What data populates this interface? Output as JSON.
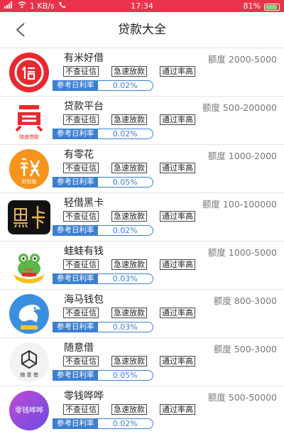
{
  "status_bar": {
    "left": "1 KB/s",
    "time": "17:34",
    "battery_pct": "81%"
  },
  "header": {
    "title": "贷款大全"
  },
  "colors": {
    "status": "#e9334a",
    "rate_blue": "#3b7fd4"
  },
  "loans": [
    {
      "name": "有米好借",
      "limit": "额度 2000-5000",
      "tags": [
        "不查征信",
        "急速放款",
        "通过率高"
      ],
      "rate_label": "参考日利率",
      "rate": "0.02%"
    },
    {
      "name": "贷款平台",
      "limit": "额度 500-200000",
      "tags": [
        "不查征信",
        "急速放款",
        "通过率高"
      ],
      "rate_label": "参考日利率",
      "rate": "0.02%",
      "logo_sub": "随速借款"
    },
    {
      "name": "有零花",
      "limit": "额度 1000-2000",
      "tags": [
        "不查征信",
        "急速放款",
        "通过率高"
      ],
      "rate_label": "参考日利率",
      "rate": "0.05%",
      "logo_sub": "秒到账"
    },
    {
      "name": "轻借黑卡",
      "limit": "额度 100-100000",
      "tags": [
        "不查征信",
        "急速放款",
        "通过率高"
      ],
      "rate_label": "参考日利率",
      "rate": "0.02%"
    },
    {
      "name": "蛙蛙有钱",
      "limit": "额度 1000-5000",
      "tags": [
        "不查征信",
        "急速放款",
        "通过率高"
      ],
      "rate_label": "参考日利率",
      "rate": "0.03%"
    },
    {
      "name": "海马钱包",
      "limit": "额度 800-3000",
      "tags": [
        "不查征信",
        "急速放款",
        "通过率高"
      ],
      "rate_label": "参考日利率",
      "rate": "0.03%"
    },
    {
      "name": "随意借",
      "limit": "额度 500-3000",
      "tags": [
        "不查征信",
        "急速放款",
        "通过率高"
      ],
      "rate_label": "参考日利率",
      "rate": "0.05%",
      "logo_sub": "随 意 借"
    },
    {
      "name": "零钱哗哗",
      "limit": "额度 500-50000",
      "tags": [
        "不查征信",
        "急速放款",
        "通过率高"
      ],
      "rate_label": "参考日利率",
      "rate": "0.02%",
      "logo_text": "零钱哗哗"
    }
  ]
}
